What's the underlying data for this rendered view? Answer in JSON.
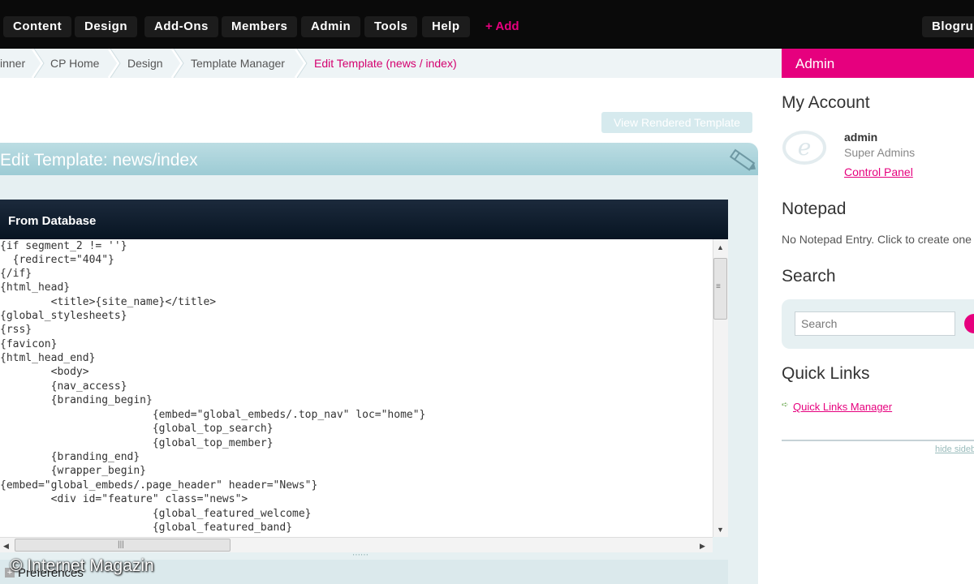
{
  "nav": {
    "items": [
      "Content",
      "Design",
      "Add-Ons",
      "Members",
      "Admin",
      "Tools",
      "Help"
    ],
    "add_label": "+ Add",
    "site_label": "Blogrun"
  },
  "breadcrumb": [
    "inner",
    "CP Home",
    "Design",
    "Template Manager",
    "Edit Template (news / index)"
  ],
  "main": {
    "view_rendered_label": "View Rendered Template",
    "panel_title": "Edit Template: news/index",
    "source_label": "From Database",
    "code_lines": [
      "{if segment_2 != ''}",
      "  {redirect=\"404\"}",
      "{/if}",
      "{html_head}",
      "        <title>{site_name}</title>",
      "{global_stylesheets}",
      "{rss}",
      "{favicon}",
      "{html_head_end}",
      "        <body>",
      "        {nav_access}",
      "        {branding_begin}",
      "                        {embed=\"global_embeds/.top_nav\" loc=\"home\"}",
      "                        {global_top_search}",
      "                        {global_top_member}",
      "        {branding_end}",
      "        {wrapper_begin}",
      "{embed=\"global_embeds/.page_header\" header=\"News\"}",
      "        <div id=\"feature\" class=\"news\">",
      "                        {global_featured_welcome}",
      "                        {global_featured_band}"
    ],
    "preferences_label": "Preferences",
    "watermark": "© Internet Magazin"
  },
  "sidebar": {
    "tab_label": "Admin",
    "account_heading": "My Account",
    "user_name": "admin",
    "user_role": "Super Admins",
    "control_panel_label": "Control Panel",
    "notepad_heading": "Notepad",
    "notepad_empty": "No Notepad Entry. Click to create one",
    "search_heading": "Search",
    "search_placeholder": "Search",
    "quicklinks_heading": "Quick Links",
    "quicklinks_manager_label": "Quick Links Manager",
    "hide_sidebar_label": "hide sidebar"
  },
  "colors": {
    "accent": "#e6007e",
    "topnav": "#0a0a0a",
    "panel_header": "#9ccbd4",
    "source_bar": "#071422"
  },
  "icons": [
    "pencil-icon",
    "expressionengine-logo",
    "search-go-icon",
    "arrow-right-icon",
    "preferences-toggle-icon"
  ]
}
